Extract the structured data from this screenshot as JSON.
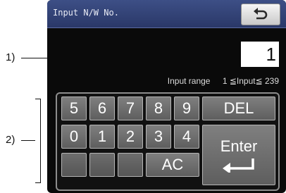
{
  "callouts": {
    "label_1": "1)",
    "label_2": "2)"
  },
  "header": {
    "title": "Input N/W No."
  },
  "display": {
    "value": "1"
  },
  "range": {
    "label": "Input range",
    "text": "1 ≦Input≦ 239"
  },
  "keypad": {
    "row1": [
      "5",
      "6",
      "7",
      "8",
      "9"
    ],
    "row2": [
      "0",
      "1",
      "2",
      "3",
      "4"
    ],
    "del": "DEL",
    "enter": "Enter",
    "ac": "AC"
  },
  "colors": {
    "titlebar": "#2f3d70",
    "key": "#6f6f6f",
    "screen": "#0a0a0a"
  },
  "icons": {
    "back": "return-arrow-icon",
    "enter": "enter-arrow-icon"
  }
}
